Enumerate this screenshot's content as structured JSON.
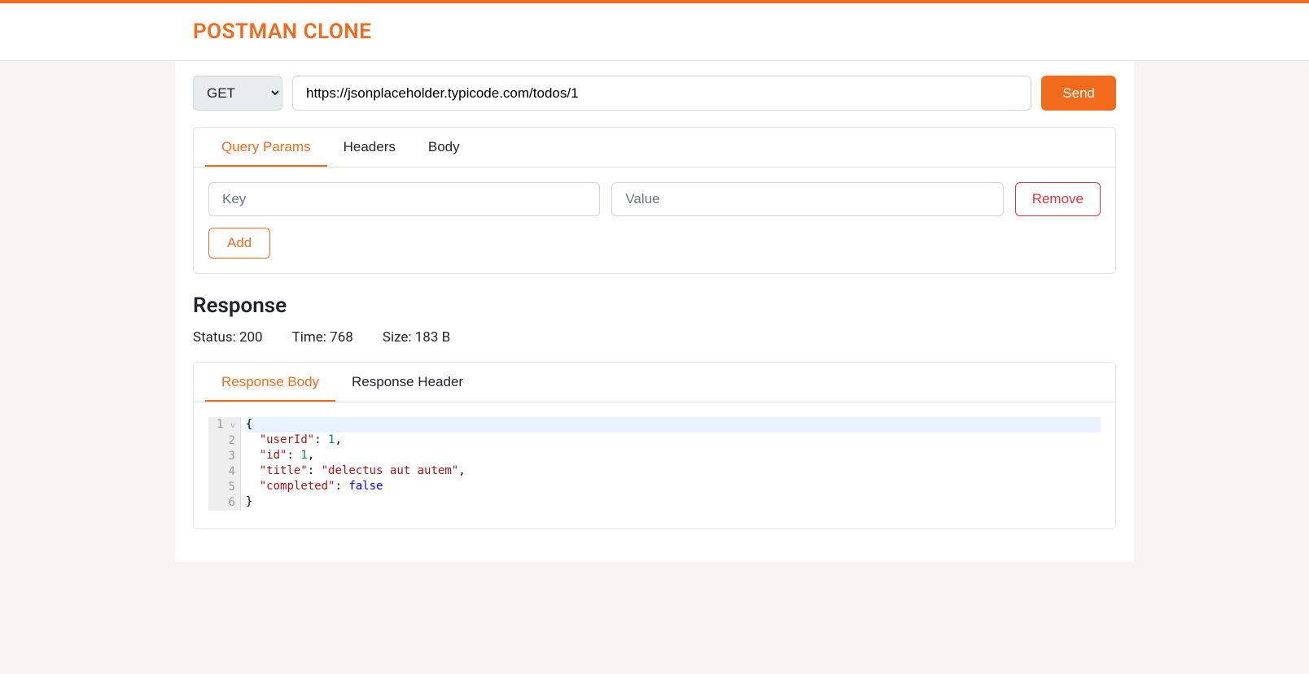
{
  "header": {
    "brand": "POSTMAN CLONE"
  },
  "request": {
    "method": "GET",
    "url": "https://jsonplaceholder.typicode.com/todos/1",
    "send_label": "Send"
  },
  "request_tabs": {
    "query_params": "Query Params",
    "headers": "Headers",
    "body": "Body",
    "active": "query_params"
  },
  "query_params": {
    "rows": [
      {
        "key": "",
        "value": ""
      }
    ],
    "key_placeholder": "Key",
    "value_placeholder": "Value",
    "remove_label": "Remove",
    "add_label": "Add"
  },
  "response": {
    "heading": "Response",
    "status_label": "Status: ",
    "status_value": "200",
    "time_label": "Time: ",
    "time_value": "768",
    "size_label": "Size: ",
    "size_value": "183 B"
  },
  "response_tabs": {
    "body": "Response Body",
    "header": "Response Header",
    "active": "body"
  },
  "response_body": {
    "line_count": 6,
    "json": {
      "userId": 1,
      "id": 1,
      "title": "delectus aut autem",
      "completed": false
    },
    "tokens": [
      [
        {
          "t": "punc",
          "v": "{"
        }
      ],
      [
        {
          "t": "pad",
          "v": "  "
        },
        {
          "t": "key",
          "v": "\"userId\""
        },
        {
          "t": "punc",
          "v": ": "
        },
        {
          "t": "num",
          "v": "1"
        },
        {
          "t": "punc",
          "v": ","
        }
      ],
      [
        {
          "t": "pad",
          "v": "  "
        },
        {
          "t": "key",
          "v": "\"id\""
        },
        {
          "t": "punc",
          "v": ": "
        },
        {
          "t": "num",
          "v": "1"
        },
        {
          "t": "punc",
          "v": ","
        }
      ],
      [
        {
          "t": "pad",
          "v": "  "
        },
        {
          "t": "key",
          "v": "\"title\""
        },
        {
          "t": "punc",
          "v": ": "
        },
        {
          "t": "str",
          "v": "\"delectus aut autem\""
        },
        {
          "t": "punc",
          "v": ","
        }
      ],
      [
        {
          "t": "pad",
          "v": "  "
        },
        {
          "t": "key",
          "v": "\"completed\""
        },
        {
          "t": "punc",
          "v": ": "
        },
        {
          "t": "bool",
          "v": "false"
        }
      ],
      [
        {
          "t": "punc",
          "v": "}"
        }
      ]
    ]
  }
}
